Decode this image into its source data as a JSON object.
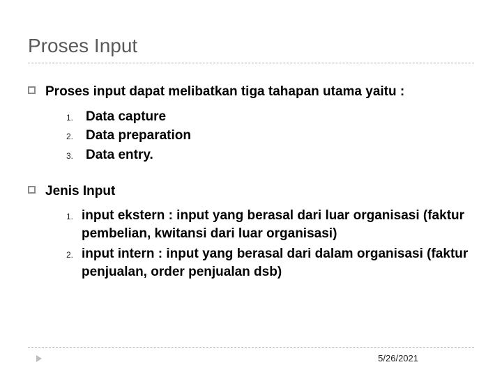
{
  "slide": {
    "title": "Proses Input",
    "item1": {
      "text": "Proses input dapat melibatkan tiga tahapan utama yaitu :",
      "sub": [
        {
          "num": "1.",
          "text": "Data capture"
        },
        {
          "num": "2.",
          "text": "Data preparation"
        },
        {
          "num": "3.",
          "text": "Data entry."
        }
      ]
    },
    "item2": {
      "text": "Jenis Input",
      "sub": [
        {
          "num": "1.",
          "text": "input ekstern : input yang berasal dari luar organisasi (faktur pembelian, kwitansi dari luar organisasi)"
        },
        {
          "num": "2.",
          "text": "input intern : input yang berasal dari dalam organisasi (faktur penjualan, order penjualan dsb)"
        }
      ]
    },
    "footer": {
      "date": "5/26/2021"
    }
  }
}
